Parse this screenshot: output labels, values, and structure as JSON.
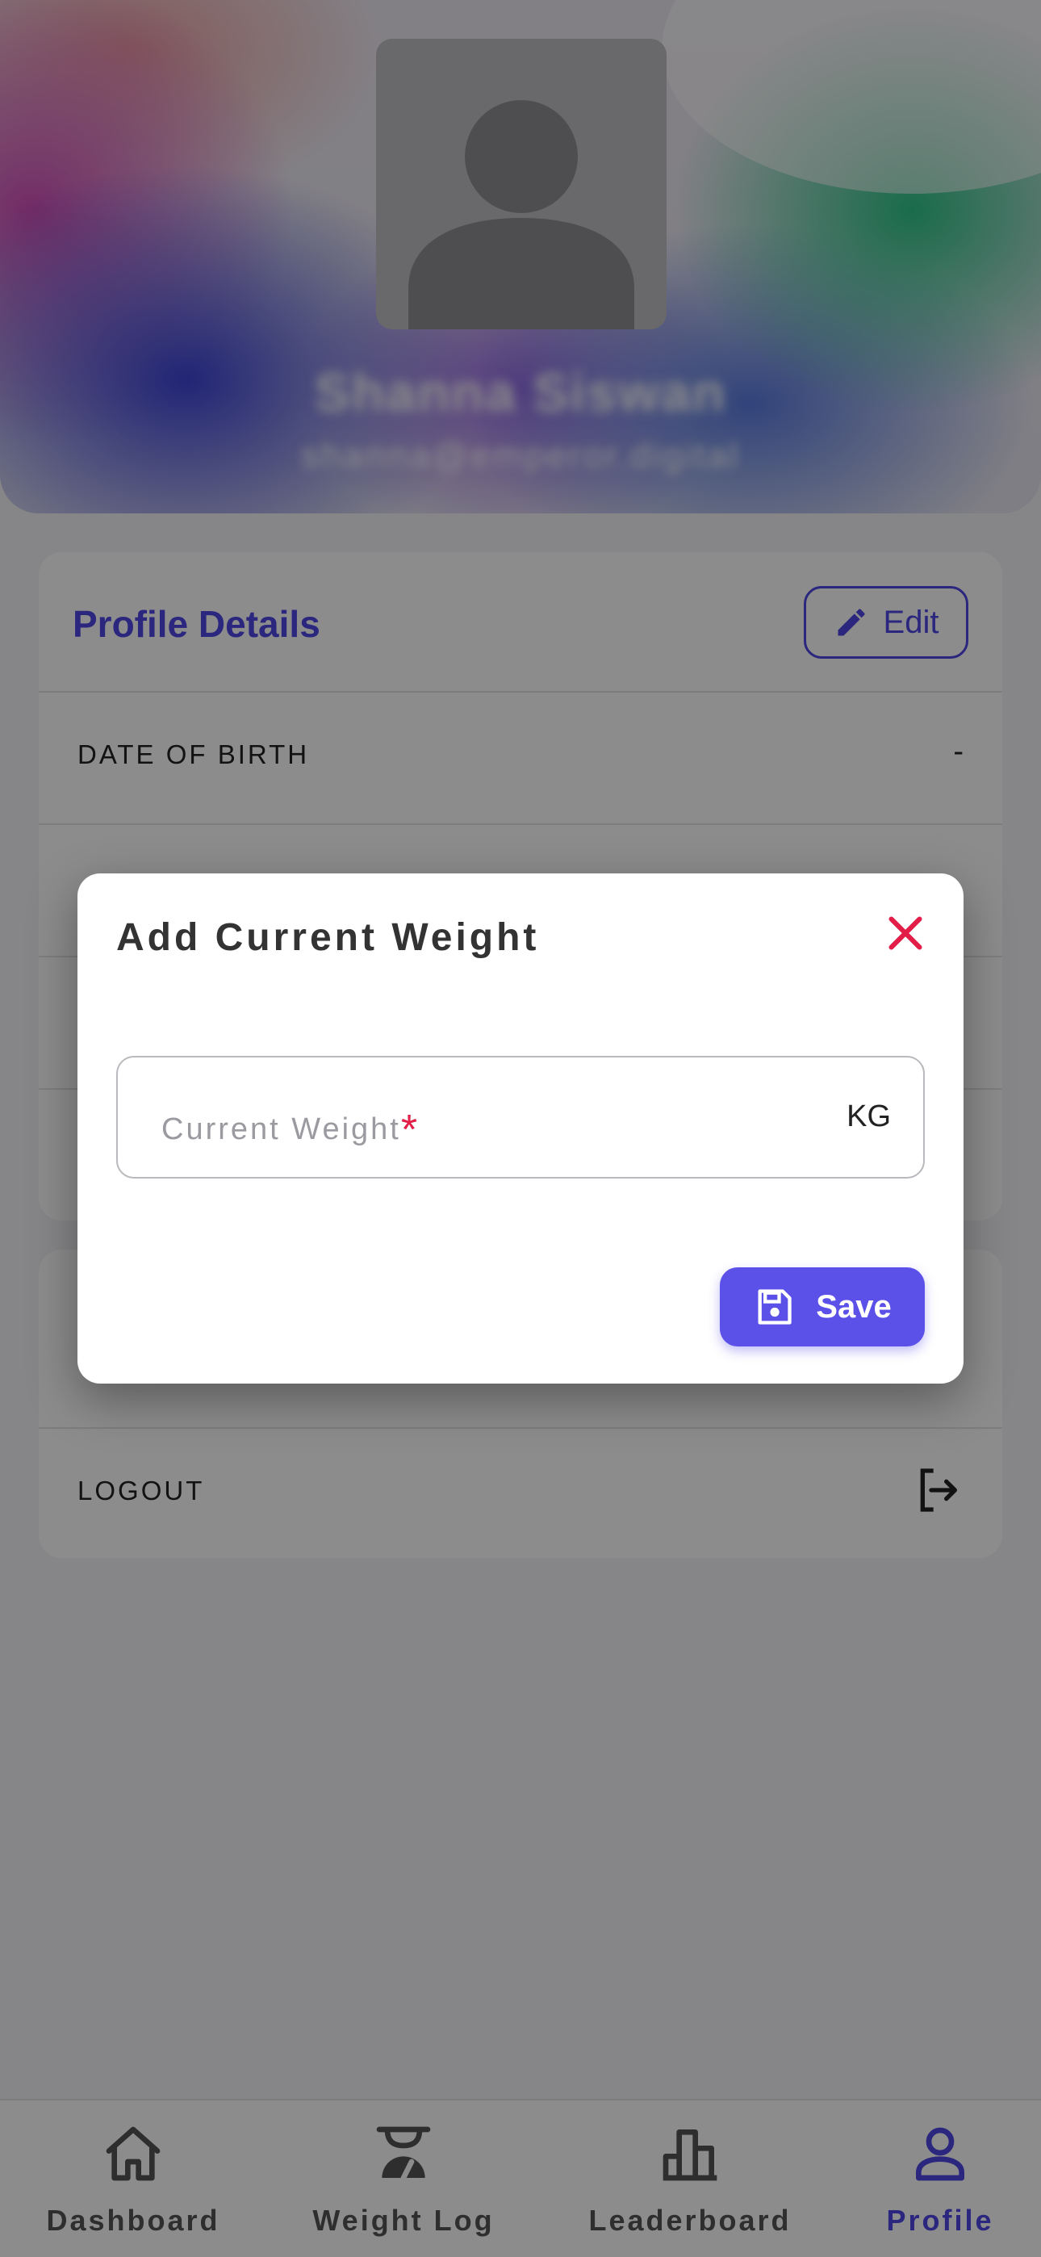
{
  "profile": {
    "name": "Shanna Siswan",
    "email": "shanna@emperor.digital"
  },
  "details": {
    "title": "Profile Details",
    "edit_label": "Edit",
    "rows": [
      {
        "label": "DATE OF BIRTH",
        "value": "-"
      }
    ]
  },
  "account": {
    "logout_label": "LOGOUT"
  },
  "modal": {
    "title": "Add Current Weight",
    "field_placeholder": "Current Weight",
    "required_mark": "*",
    "unit": "KG",
    "save_label": "Save"
  },
  "nav": {
    "items": [
      {
        "label": "Dashboard",
        "icon": "home-icon"
      },
      {
        "label": "Weight Log",
        "icon": "scale-icon"
      },
      {
        "label": "Leaderboard",
        "icon": "bar-chart-icon"
      },
      {
        "label": "Profile",
        "icon": "user-icon",
        "active": true
      }
    ]
  },
  "colors": {
    "accent": "#4f46e5",
    "danger": "#e11d48"
  }
}
